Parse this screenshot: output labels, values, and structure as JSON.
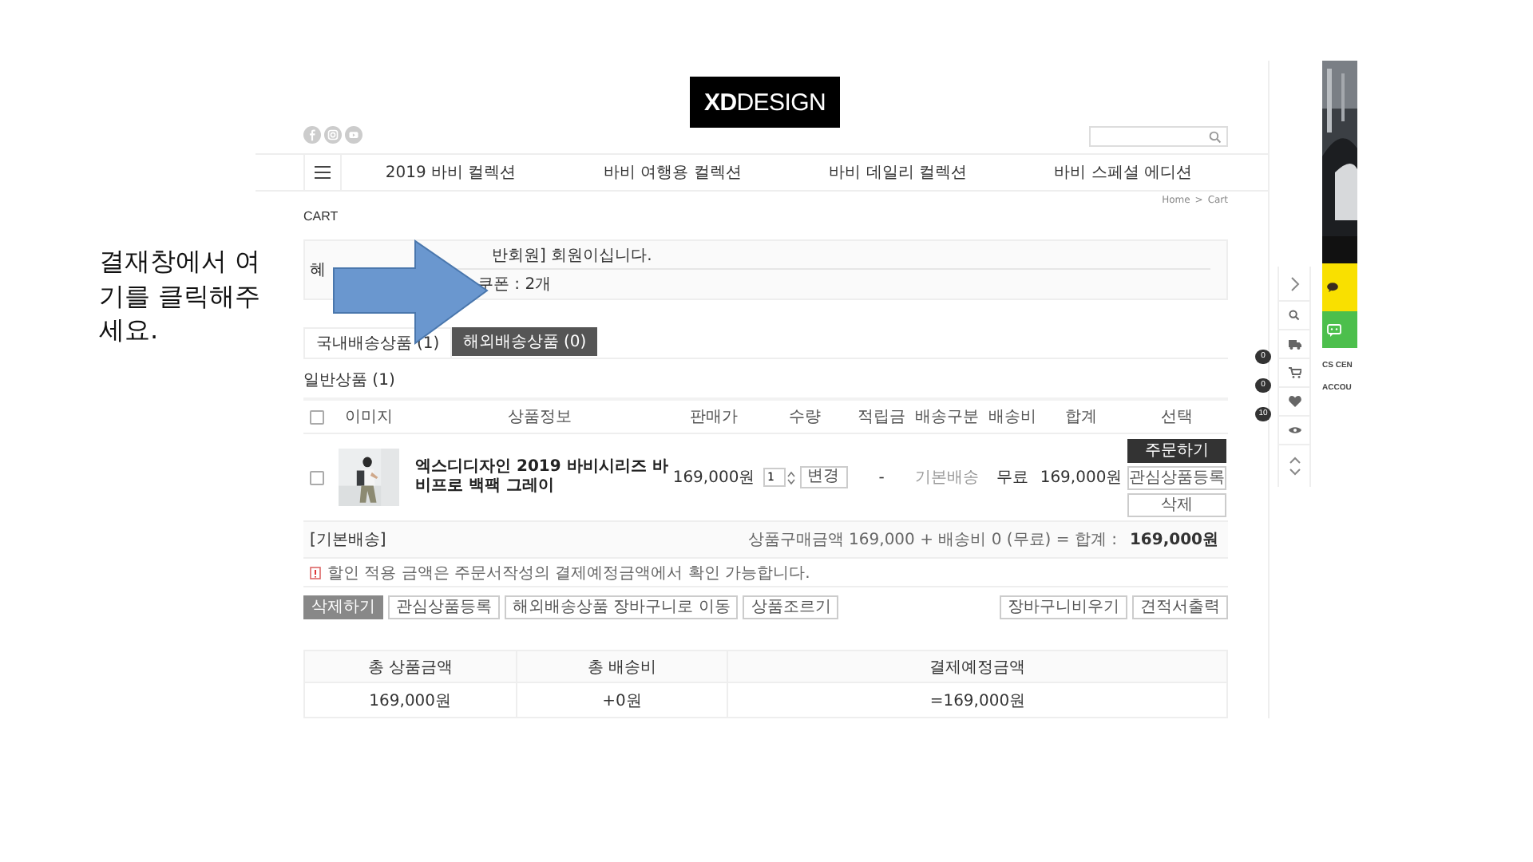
{
  "annotation": {
    "text": "결재창에서 여기를 클릭해주세요."
  },
  "header": {
    "logo_bold": "XD",
    "logo_rest": "DESIGN"
  },
  "nav": {
    "items": [
      "2019 바비 컬렉션",
      "바비 여행용 컬렉션",
      "바비 데일리 컬렉션",
      "바비 스페셜 에디션"
    ]
  },
  "breadcrumb": {
    "items": [
      "Home",
      "Cart"
    ],
    "separator": ">"
  },
  "page_title": "CART",
  "benefit": {
    "label": "혜",
    "member_text": "반회원] 회원이십니다.",
    "coupon": "쿠폰 : 2개"
  },
  "tabs": [
    {
      "label": "국내배송상품 (1)",
      "selected": true
    },
    {
      "label": "해외배송상품 (0)",
      "selected": false
    }
  ],
  "section_title": "일반상품 (1)",
  "table": {
    "header_checked": false,
    "columns": [
      "이미지",
      "상품정보",
      "판매가",
      "수량",
      "적립금",
      "배송구분",
      "배송비",
      "합계",
      "선택"
    ],
    "rows": [
      {
        "checked": false,
        "name": "엑스디디자인 2019 바비시리즈 바비프로 백팩 그레이",
        "price": "169,000원",
        "qty": "1",
        "change_label": "변경",
        "points": "-",
        "delivery_type": "기본배송",
        "delivery_fee": "무료",
        "total": "169,000원",
        "actions": [
          {
            "label": "주문하기",
            "kind": "primary"
          },
          {
            "label": "관심상품등록",
            "kind": "default"
          },
          {
            "label": "삭제",
            "kind": "default"
          }
        ]
      }
    ]
  },
  "subtotal": {
    "label": "[기본배송]",
    "formula": "상품구매금액 169,000 + 배송비 0 (무료) = 합계 :",
    "amount": "169,000원"
  },
  "notice": "할인 적용 금액은 주문서작성의 결제예정금액에서 확인 가능합니다.",
  "actions_left": [
    {
      "label": "삭제하기",
      "kind": "primary"
    },
    {
      "label": "관심상품등록",
      "kind": "default"
    },
    {
      "label": "해외배송상품 장바구니로 이동",
      "kind": "default"
    },
    {
      "label": "상품조르기",
      "kind": "default"
    }
  ],
  "actions_right": [
    "장바구니비우기",
    "견적서출력"
  ],
  "summary": {
    "columns": [
      "총 상품금액",
      "총 배송비",
      "결제예정금액"
    ],
    "values": [
      "169,000원",
      "+0원",
      "=169,000원"
    ]
  },
  "quick_bar": {
    "items": [
      {
        "kind": "next"
      },
      {
        "kind": "search"
      },
      {
        "kind": "truck"
      },
      {
        "kind": "cart",
        "badge": "0"
      },
      {
        "kind": "heart",
        "badge": "0"
      },
      {
        "kind": "eye",
        "badge": "10"
      },
      {
        "kind": "updown"
      }
    ]
  },
  "side_banner": {
    "labels": [
      "CS CEN",
      "ACCOU"
    ]
  }
}
